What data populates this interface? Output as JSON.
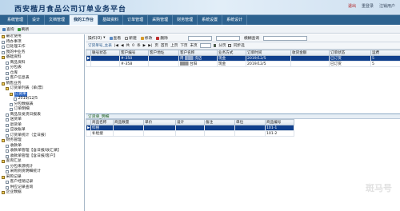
{
  "app": {
    "title": "西安楷月食品公司订单业务平台"
  },
  "header": {
    "links": [
      "退出",
      "重登录",
      "注销用户"
    ]
  },
  "nav": {
    "tabs": [
      "系统管理",
      "设计",
      "文档管理",
      "我的工作台",
      "基础资料",
      "订单管理",
      "采购管理",
      "财务管理",
      "系统设置",
      "系统设计"
    ]
  },
  "toolbar": {
    "items": [
      "查询",
      "刷新"
    ]
  },
  "sidebar": {
    "items": [
      {
        "label": "最近使用",
        "icon": "folder",
        "indent": 0
      },
      {
        "label": "待办事项",
        "icon": "doc",
        "indent": 0
      },
      {
        "label": "已处理工作",
        "icon": "doc",
        "indent": 0
      },
      {
        "label": "我的中业务",
        "icon": "doc",
        "indent": 0
      },
      {
        "label": "基础资料",
        "icon": "folder",
        "indent": 0
      },
      {
        "label": "商品资料",
        "icon": "doc",
        "indent": 1
      },
      {
        "label": "分包表",
        "icon": "doc",
        "indent": 1
      },
      {
        "label": "仓库",
        "icon": "doc",
        "indent": 1
      },
      {
        "label": "客户信息表",
        "icon": "doc",
        "indent": 1
      },
      {
        "label": "销售业务",
        "icon": "folder",
        "indent": 0
      },
      {
        "label": "订货单列表（单/票）",
        "icon": "folder",
        "indent": 1
      },
      {
        "label": "订货单",
        "icon": "folder",
        "indent": 2
      },
      {
        "label": "2019/12/5",
        "icon": "doc",
        "indent": 3
      },
      {
        "label": "分包数据表",
        "icon": "doc",
        "indent": 2
      },
      {
        "label": "订单明细",
        "icon": "doc",
        "indent": 2
      },
      {
        "label": "商品及发货日报表",
        "icon": "doc",
        "indent": 1
      },
      {
        "label": "送货单",
        "icon": "doc",
        "indent": 1
      },
      {
        "label": "退货单",
        "icon": "doc",
        "indent": 1
      },
      {
        "label": "应收账单",
        "icon": "doc",
        "indent": 1
      },
      {
        "label": "订货单统计（全日报）",
        "icon": "doc",
        "indent": 1
      },
      {
        "label": "财务管理",
        "icon": "folder",
        "indent": 0
      },
      {
        "label": "收款单",
        "icon": "doc",
        "indent": 1
      },
      {
        "label": "收款单管理【含日报/收汇录】",
        "icon": "doc",
        "indent": 1
      },
      {
        "label": "收款单管理【含日报/客户】",
        "icon": "doc",
        "indent": 1
      },
      {
        "label": "查询汇总",
        "icon": "folder",
        "indent": 0
      },
      {
        "label": "分包来源统计",
        "icon": "doc",
        "indent": 1
      },
      {
        "label": "采购到货明细统计",
        "icon": "doc",
        "indent": 1
      },
      {
        "label": "采购记录",
        "icon": "folder",
        "indent": 0
      },
      {
        "label": "客户经销记录",
        "icon": "doc",
        "indent": 1
      },
      {
        "label": "供应记录查询",
        "icon": "doc",
        "indent": 1
      },
      {
        "label": "企业数据",
        "icon": "folder",
        "indent": 0
      }
    ],
    "selected": 11
  },
  "main": {
    "buttons": [
      "操作(O)",
      "查看",
      "新建",
      "修改",
      "删除"
    ],
    "search_label": "模糊查询",
    "pagebar": {
      "label": "订货单号_主表",
      "parts": [
        "共",
        "0",
        "条",
        "1",
        "/",
        "1",
        "页",
        "首页",
        "上页",
        "下页",
        "末页",
        "页码",
        "文本框",
        "分页",
        "同步选"
      ],
      "checks": [
        "分页",
        "同步选"
      ]
    },
    "grid": {
      "columns": [
        "联号状态",
        "客户编号",
        "客户地址",
        "客户名称",
        "业务方式",
        "订单时间",
        "收货金额",
        "订单状态",
        "运费"
      ],
      "rows": [
        [
          "",
          "#-350",
          "",
          "周 ▒▒▒ 洗店",
          "现金",
          "2019/12/5",
          "",
          "已订货",
          "5"
        ],
        [
          "",
          "#-358",
          "",
          "▒▒▒ 台阳",
          "现金",
          "2019/12/5",
          "",
          "已订货",
          "5"
        ]
      ]
    },
    "detail": {
      "title": "订货单_明细",
      "columns": [
        "商品名称",
        "商品数量",
        "单价",
        "设计",
        "备注",
        "单位",
        "商品编号"
      ],
      "rows": [
        [
          "综搜",
          "",
          "",
          "",
          "",
          "",
          "101-1"
        ],
        [
          "补给搜",
          "",
          "",
          "",
          "",
          "",
          "101-2"
        ]
      ]
    }
  },
  "watermark": "斑马号"
}
